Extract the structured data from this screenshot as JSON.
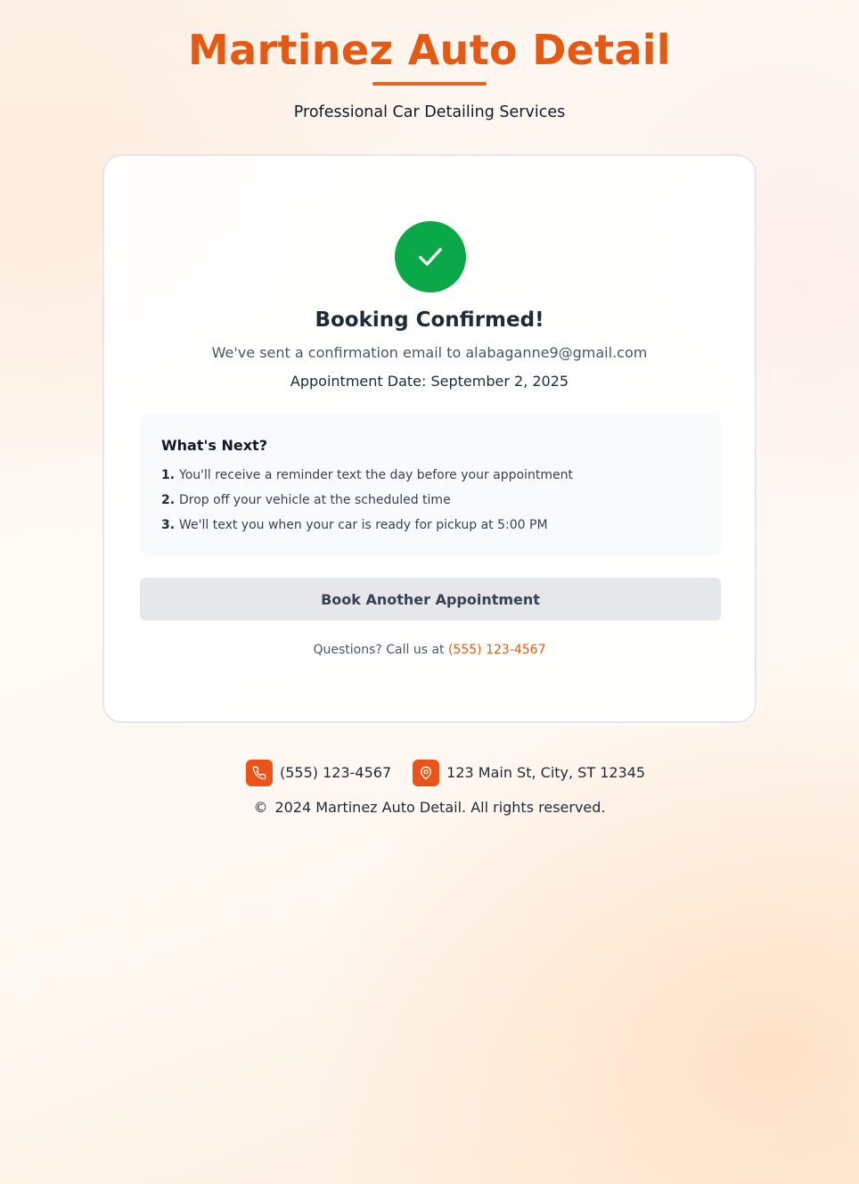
{
  "header": {
    "brand_title": "Martinez Auto Detail",
    "subtitle": "Professional Car Detailing Services"
  },
  "confirmation": {
    "icon": "check-icon",
    "title": "Booking Confirmed!",
    "email_message": "We've sent a confirmation email to alabaganne9@gmail.com",
    "appointment_date": "Appointment Date: September 2, 2025"
  },
  "next_steps": {
    "title": "What's Next?",
    "items": [
      {
        "number": "1.",
        "text": "You'll receive a reminder text the day before your appointment"
      },
      {
        "number": "2.",
        "text": "Drop off your vehicle at the scheduled time"
      },
      {
        "number": "3.",
        "text": "We'll text you when your car is ready for pickup at 5:00 PM"
      }
    ]
  },
  "actions": {
    "book_another_label": "Book Another Appointment"
  },
  "questions": {
    "prefix": "Questions? Call us at",
    "phone": "(555) 123-4567"
  },
  "footer": {
    "phone_icon": "phone-icon",
    "phone": "(555) 123-4567",
    "location_icon": "map-pin-icon",
    "address": "123 Main St, City, ST 12345",
    "copyright_symbol": "©",
    "copyright": "2024 Martinez Auto Detail. All rights reserved."
  },
  "colors": {
    "brand_orange": "#e35a14",
    "success_green": "#0ba84a",
    "icon_badge_orange": "#e8541a",
    "button_gray": "#e5e7eb"
  }
}
